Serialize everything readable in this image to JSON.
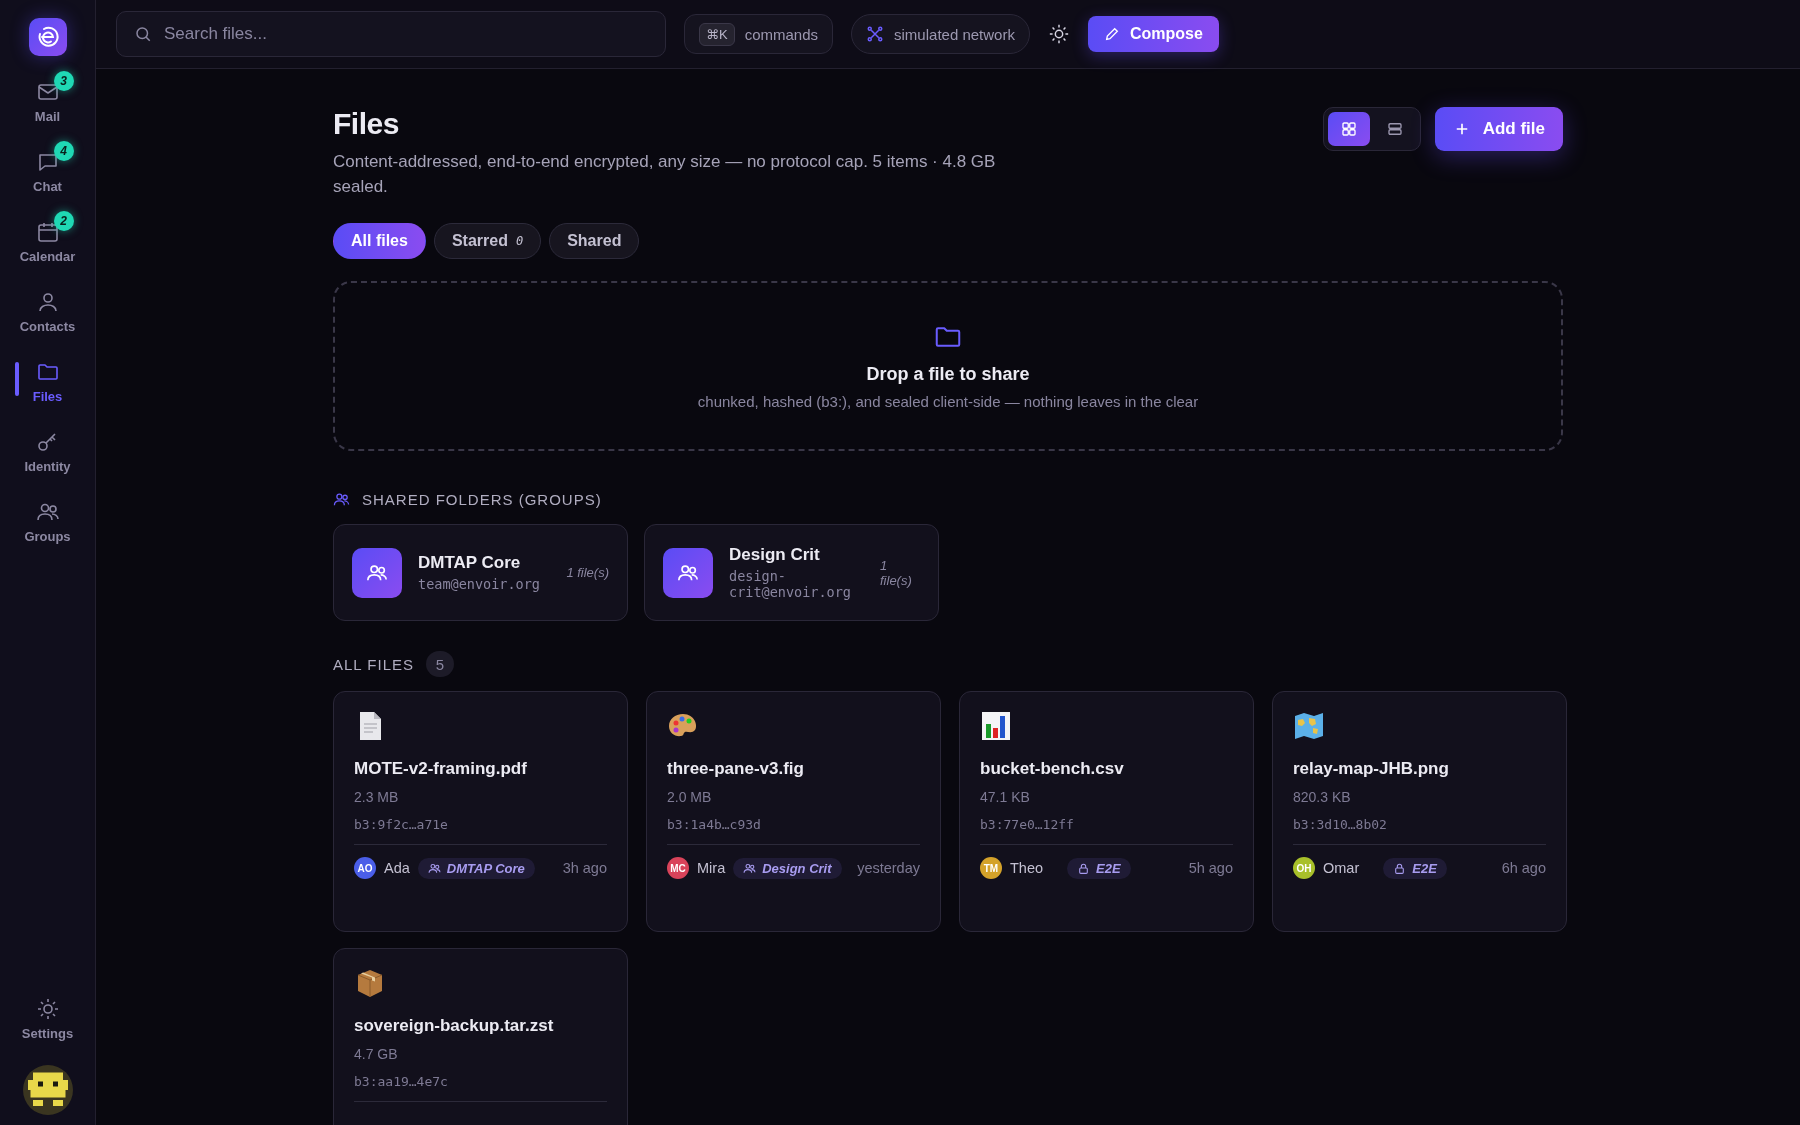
{
  "nav": [
    {
      "kind": "mail",
      "label": "Mail",
      "badge": "3",
      "selected": false
    },
    {
      "kind": "chat",
      "label": "Chat",
      "badge": "4",
      "selected": false
    },
    {
      "kind": "calendar",
      "label": "Calendar",
      "badge": "2",
      "selected": false
    },
    {
      "kind": "contacts",
      "label": "Contacts",
      "selected": false
    },
    {
      "kind": "files",
      "label": "Files",
      "selected": true
    },
    {
      "kind": "identity",
      "label": "Identity",
      "selected": false
    },
    {
      "kind": "groups",
      "label": "Groups",
      "selected": false
    }
  ],
  "settings": {
    "label": "Settings"
  },
  "topbar": {
    "search": {
      "placeholder": "Search files..."
    },
    "shortcut": "⌘K",
    "commands": "commands",
    "network": "simulated network",
    "compose": "Compose"
  },
  "page": {
    "title": "Files",
    "subtitle": "Content-addressed, end-to-end encrypted, any size — no protocol cap. 5 items · 4.8 GB sealed.",
    "add_button": "Add file",
    "view_toggle": [
      {
        "kind": "grid",
        "selected": true
      },
      {
        "kind": "list",
        "selected": false
      }
    ]
  },
  "filters": [
    {
      "label": "All files",
      "selected": true
    },
    {
      "label": "Starred",
      "count": "0",
      "selected": false
    },
    {
      "label": "Shared",
      "selected": false
    }
  ],
  "dropzone": {
    "title": "Drop a file to share",
    "hint": "chunked, hashed (b3:), and sealed client-side — nothing leaves in the clear"
  },
  "shared_folders": {
    "heading": "SHARED FOLDERS (GROUPS)",
    "items": [
      {
        "name": "DMTAP Core",
        "address": "team@envoir.org",
        "count": "1 file(s)"
      },
      {
        "name": "Design Crit",
        "address": "design-crit@envoir.org",
        "count": "1 file(s)"
      }
    ]
  },
  "all_files": {
    "heading": "ALL FILES",
    "count": "5",
    "items": [
      {
        "kind": "document",
        "name": "MOTE-v2-framing.pdf",
        "size": "2.3 MB",
        "hash": "b3:9f2c…a71e",
        "owner": {
          "initials": "AO",
          "name": "Ada",
          "color": "#4a5ee8"
        },
        "tag": {
          "kind": "group",
          "label": "DMTAP Core"
        },
        "time": "3h ago"
      },
      {
        "kind": "palette",
        "name": "three-pane-v3.fig",
        "size": "2.0 MB",
        "hash": "b3:1a4b…c93d",
        "owner": {
          "initials": "MC",
          "name": "Mira",
          "color": "#d9435a"
        },
        "tag": {
          "kind": "group",
          "label": "Design Crit"
        },
        "time": "yesterday"
      },
      {
        "kind": "chart",
        "name": "bucket-bench.csv",
        "size": "47.1 KB",
        "hash": "b3:77e0…12ff",
        "owner": {
          "initials": "TM",
          "name": "Theo",
          "color": "#d4a22a"
        },
        "tag": {
          "kind": "e2e",
          "label": "E2E"
        },
        "time": "5h ago"
      },
      {
        "kind": "map",
        "name": "relay-map-JHB.png",
        "size": "820.3 KB",
        "hash": "b3:3d10…8b02",
        "owner": {
          "initials": "OH",
          "name": "Omar",
          "color": "#a8c02a"
        },
        "tag": {
          "kind": "e2e",
          "label": "E2E"
        },
        "time": "6h ago"
      },
      {
        "kind": "package",
        "name": "sovereign-backup.tar.zst",
        "size": "4.7 GB",
        "hash": "b3:aa19…4e7c"
      }
    ]
  }
}
